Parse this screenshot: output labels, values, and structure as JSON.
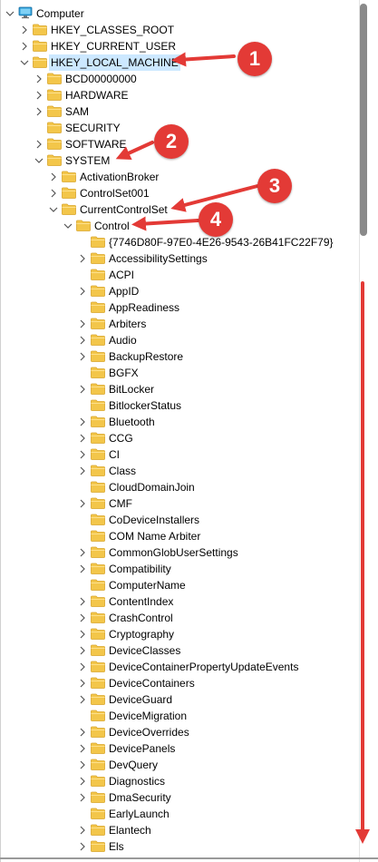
{
  "tree": {
    "root": "Computer",
    "hives": [
      "HKEY_CLASSES_ROOT",
      "HKEY_CURRENT_USER",
      "HKEY_LOCAL_MACHINE"
    ],
    "hklm_children": [
      "BCD00000000",
      "HARDWARE",
      "SAM",
      "SECURITY",
      "SOFTWARE",
      "SYSTEM"
    ],
    "system_children": [
      "ActivationBroker",
      "ControlSet001",
      "CurrentControlSet"
    ],
    "ccs_children": [
      "Control"
    ],
    "control_children": [
      "{7746D80F-97E0-4E26-9543-26B41FC22F79}",
      "AccessibilitySettings",
      "ACPI",
      "AppID",
      "AppReadiness",
      "Arbiters",
      "Audio",
      "BackupRestore",
      "BGFX",
      "BitLocker",
      "BitlockerStatus",
      "Bluetooth",
      "CCG",
      "CI",
      "Class",
      "CloudDomainJoin",
      "CMF",
      "CoDeviceInstallers",
      "COM Name Arbiter",
      "CommonGlobUserSettings",
      "Compatibility",
      "ComputerName",
      "ContentIndex",
      "CrashControl",
      "Cryptography",
      "DeviceClasses",
      "DeviceContainerPropertyUpdateEvents",
      "DeviceContainers",
      "DeviceGuard",
      "DeviceMigration",
      "DeviceOverrides",
      "DevicePanels",
      "DevQuery",
      "Diagnostics",
      "DmaSecurity",
      "EarlyLaunch",
      "Elantech",
      "Els"
    ],
    "selected": "HKEY_LOCAL_MACHINE"
  },
  "annotations": [
    "1",
    "2",
    "3",
    "4"
  ],
  "colors": {
    "annotation": "#e33a36",
    "folder": "#f3c64a",
    "selection": "#cce8ff",
    "scroll_thumb": "#8a8a8a"
  },
  "icons": {
    "root": "computer-icon",
    "folder": "folder-icon",
    "expand": "chevron-right-icon",
    "collapse": "chevron-down-icon"
  }
}
